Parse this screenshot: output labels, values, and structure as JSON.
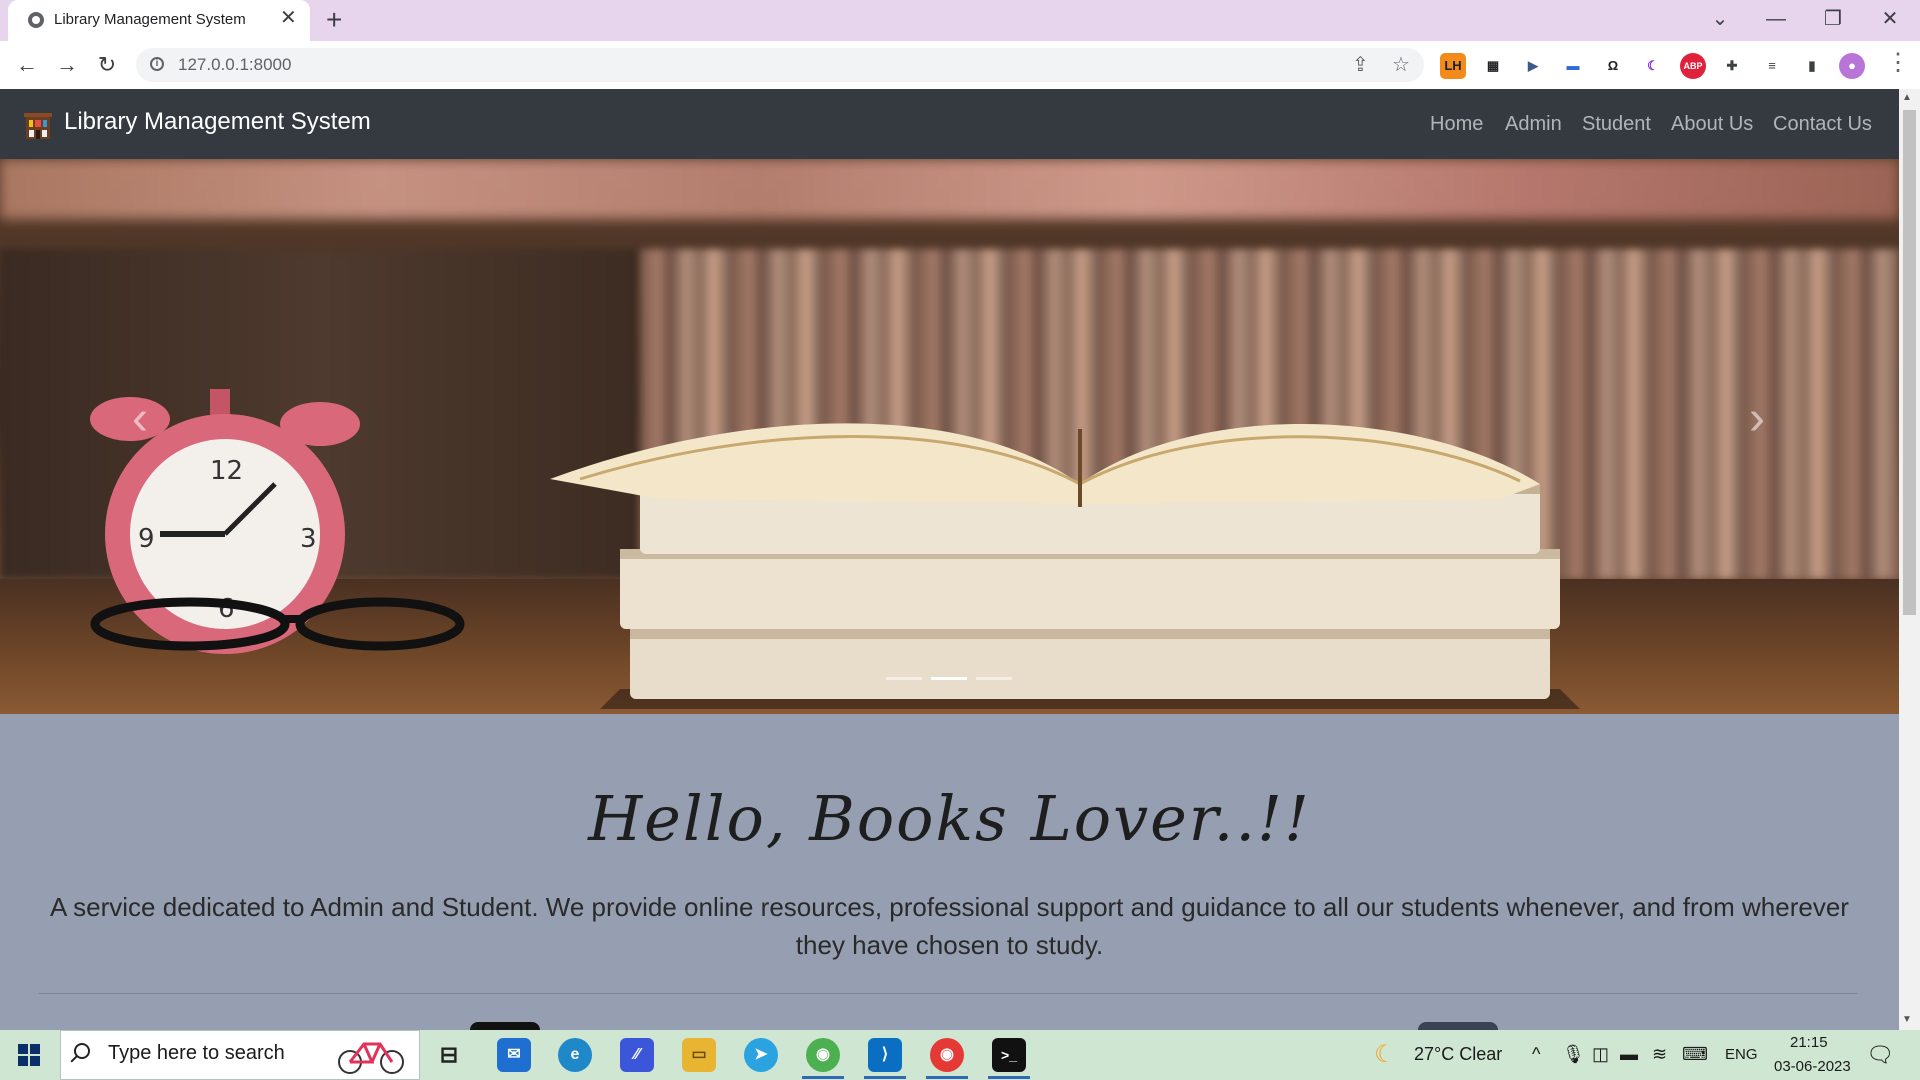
{
  "browser": {
    "tab_title": "Library Management System",
    "tab_close": "✕",
    "new_tab": "+",
    "url": "127.0.0.1:8000",
    "win_dropdown": "⌄",
    "win_minimize": "—",
    "win_restore": "❐",
    "win_close": "✕",
    "back": "←",
    "forward": "→",
    "reload": "↻",
    "share": "⇪",
    "bookmark": "☆",
    "menu": "⋮",
    "extensions": [
      {
        "name": "lh-extension-icon",
        "label": "LH",
        "color": "#1f1f1f"
      },
      {
        "name": "extension-icon-2",
        "label": "▦",
        "color": "#202124"
      },
      {
        "name": "extension-icon-3",
        "label": "▶",
        "color": "#3c5a8a"
      },
      {
        "name": "extension-icon-4",
        "label": "▬",
        "color": "#2f6bd8"
      },
      {
        "name": "extension-icon-5",
        "label": "Ω",
        "color": "#ffffff"
      },
      {
        "name": "dark-mode-icon",
        "label": "☾",
        "color": "#8a2be2"
      },
      {
        "name": "adblock-icon",
        "label": "ABP",
        "color": "#e0213b"
      },
      {
        "name": "puzzle-icon",
        "label": "✚",
        "color": "#3c4043"
      },
      {
        "name": "reading-list-icon",
        "label": "≡",
        "color": "#3c4043"
      },
      {
        "name": "side-panel-icon",
        "label": "▮",
        "color": "#3c4043"
      },
      {
        "name": "profile-avatar",
        "label": "●",
        "color": "#b874d6"
      }
    ]
  },
  "site": {
    "brand": "Library Management System",
    "nav": [
      "Home",
      "Admin",
      "Student",
      "About Us",
      "Contact Us"
    ],
    "carousel_prev": "‹",
    "carousel_next": "›",
    "carousel_active_index": 1,
    "hello": "Hello, Books Lover..!!",
    "lead": "A service dedicated to Admin and Student. We provide online resources, professional support and guidance to all our students whenever, and from wherever they have chosen to study."
  },
  "taskbar": {
    "search_placeholder": "Type here to search",
    "weather": "27°C  Clear",
    "lang": "ENG",
    "time": "21:15",
    "date": "03-06-2023"
  },
  "colors": {
    "navbar": "#343a40",
    "welcome_bg": "#969fb1",
    "tabstrip": "#e7d5ee",
    "taskbar": "#cfe6d2"
  }
}
